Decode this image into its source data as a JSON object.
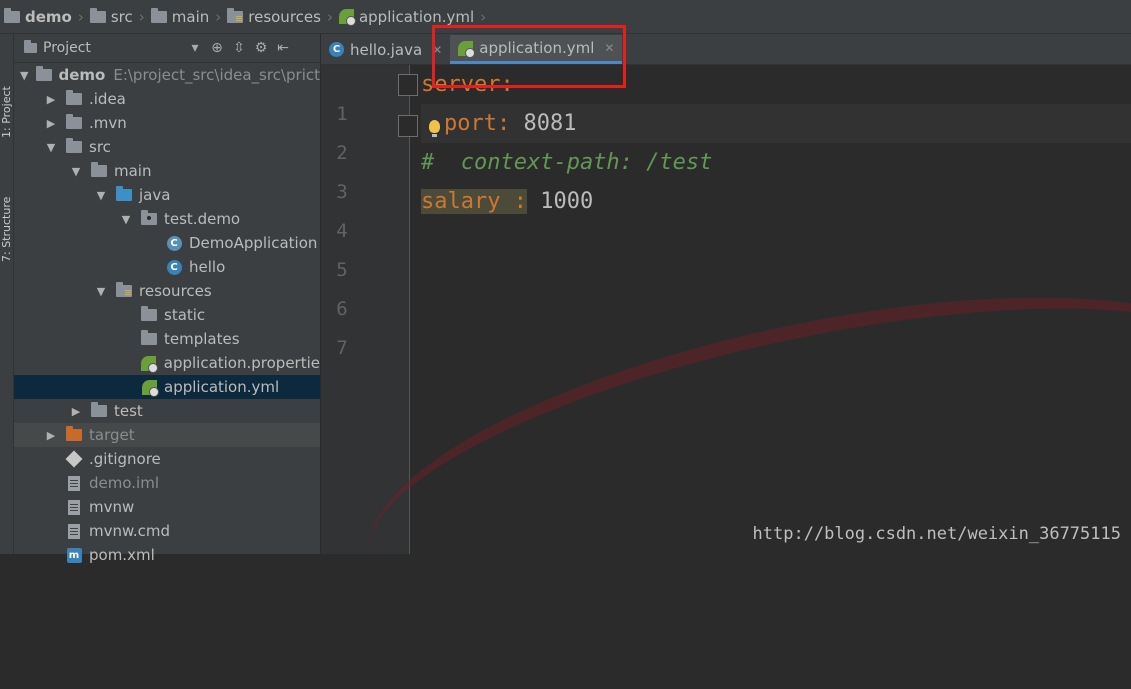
{
  "breadcrumb": {
    "items": [
      "demo",
      "src",
      "main",
      "resources",
      "application.yml"
    ]
  },
  "side_tabs": {
    "project": "1: Project",
    "structure": "7: Structure"
  },
  "project_panel": {
    "title": "Project",
    "tree": [
      {
        "label": "demo",
        "path": "E:\\project_src\\idea_src\\prict",
        "level": 0,
        "expanded": true,
        "icon": "module-folder-icon"
      },
      {
        "label": ".idea",
        "level": 1,
        "expanded": false,
        "icon": "folder-icon"
      },
      {
        "label": ".mvn",
        "level": 1,
        "expanded": false,
        "icon": "folder-icon"
      },
      {
        "label": "src",
        "level": 1,
        "expanded": true,
        "icon": "folder-icon"
      },
      {
        "label": "main",
        "level": 2,
        "expanded": true,
        "icon": "folder-icon"
      },
      {
        "label": "java",
        "level": 3,
        "expanded": true,
        "icon": "source-folder-icon"
      },
      {
        "label": "test.demo",
        "level": 4,
        "expanded": true,
        "icon": "package-icon"
      },
      {
        "label": "DemoApplication",
        "level": 5,
        "icon": "spring-class-icon"
      },
      {
        "label": "hello",
        "level": 5,
        "icon": "class-icon"
      },
      {
        "label": "resources",
        "level": 3,
        "expanded": true,
        "icon": "resources-folder-icon"
      },
      {
        "label": "static",
        "level": 4,
        "icon": "folder-icon"
      },
      {
        "label": "templates",
        "level": 4,
        "icon": "folder-icon"
      },
      {
        "label": "application.propertie",
        "level": 4,
        "icon": "spring-config-icon"
      },
      {
        "label": "application.yml",
        "level": 4,
        "icon": "spring-config-icon",
        "selected": true
      },
      {
        "label": "test",
        "level": 2,
        "expanded": false,
        "icon": "folder-icon"
      },
      {
        "label": "target",
        "level": 1,
        "expanded": false,
        "icon": "excluded-folder-icon"
      },
      {
        "label": ".gitignore",
        "level": 1,
        "icon": "git-icon"
      },
      {
        "label": "demo.iml",
        "level": 1,
        "icon": "file-icon"
      },
      {
        "label": "mvnw",
        "level": 1,
        "icon": "file-icon"
      },
      {
        "label": "mvnw.cmd",
        "level": 1,
        "icon": "file-icon"
      },
      {
        "label": "pom.xml",
        "level": 1,
        "icon": "maven-icon"
      }
    ]
  },
  "editor": {
    "tabs": [
      {
        "label": "hello.java",
        "icon": "class-icon",
        "active": false
      },
      {
        "label": "application.yml",
        "icon": "spring-config-icon",
        "active": true
      }
    ],
    "line_numbers": [
      "1",
      "2",
      "3",
      "4",
      "5",
      "6",
      "7"
    ],
    "lines": {
      "l1_key": "server:",
      "l2_key": "port:",
      "l2_val": " 8081",
      "l3_comment": "#  context-path: /test",
      "l4_key": "salary :",
      "l4_val": " 1000"
    }
  },
  "watermark": "http://blog.csdn.net/weixin_36775115",
  "colors": {
    "accent": "#4a88c7",
    "annotation_box": "#e61e1e",
    "yaml_key": "#cc7832",
    "comment": "#629755"
  }
}
